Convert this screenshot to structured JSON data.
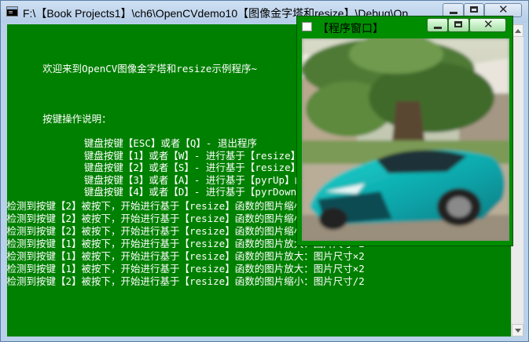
{
  "console": {
    "title": "F:\\【Book Projects1】\\ch6\\OpenCVdemo10【图像金字塔和resize】\\Debug\\Op...",
    "lines": [
      "      欢迎来到OpenCV图像金字塔和resize示例程序~",
      "",
      "",
      "      按键操作说明：",
      "",
      "             键盘按键【ESC】或者【Q】- 退出程序",
      "             键盘按键【1】或者【W】- 进行基于【resize】函数的图片放大",
      "             键盘按键【2】或者【S】- 进行基于【resize】函数的图片缩小",
      "             键盘按键【3】或者【A】- 进行基于【pyrUp】函数的图片放大",
      "             键盘按键【4】或者【D】- 进行基于【pyrDown】函数的图片缩小",
      ">检测到按键【2】被按下，开始进行基于【resize】函数的图片缩小：图片尺寸/2",
      ">检测到按键【2】被按下，开始进行基于【resize】函数的图片缩小：图片尺寸/2",
      ">检测到按键【2】被按下，开始进行基于【resize】函数的图片缩小：图片尺寸/2",
      ">检测到按键【1】被按下，开始进行基于【resize】函数的图片放大：图片尺寸×2",
      ">检测到按键【1】被按下，开始进行基于【resize】函数的图片放大：图片尺寸×2",
      ">检测到按键【1】被按下，开始进行基于【resize】函数的图片放大：图片尺寸×2",
      ">检测到按键【2】被按下，开始进行基于【resize】函数的图片缩小：图片尺寸/2"
    ]
  },
  "image_window": {
    "title": "【程序窗口】"
  },
  "colors": {
    "console_bg": "#008000",
    "console_text": "#ffffff",
    "image_window_frame": "#008d00"
  },
  "icons": {
    "console": "cmd-icon",
    "image_window": "app-icon",
    "minimize": "minimize-icon",
    "maximize": "maximize-icon",
    "close": "close-icon"
  }
}
